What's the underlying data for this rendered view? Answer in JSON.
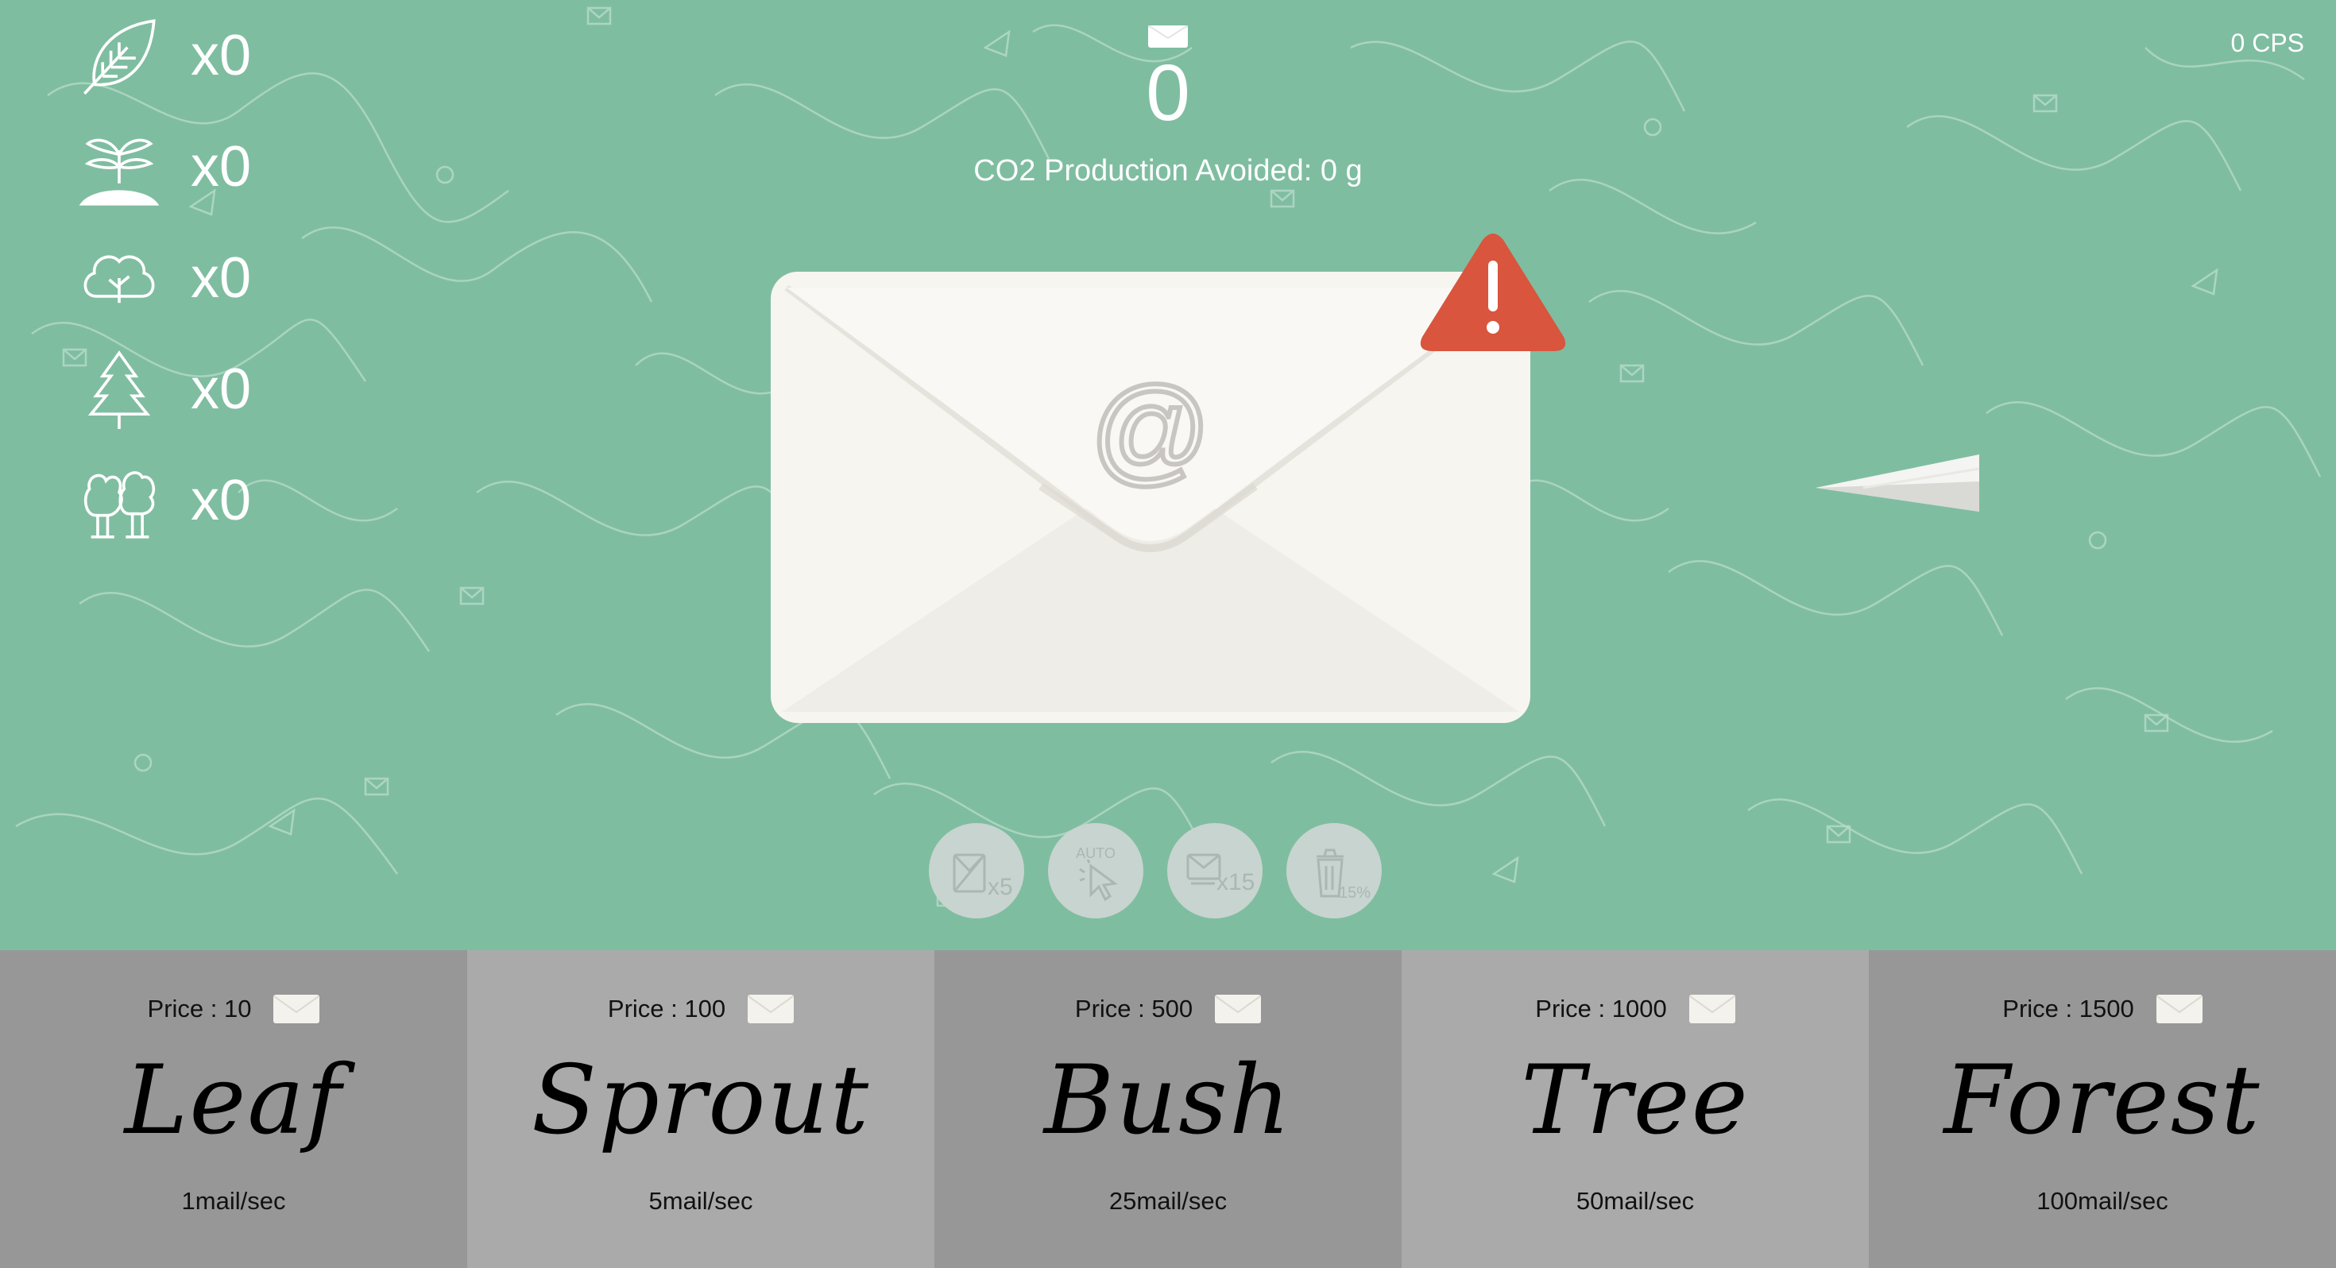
{
  "header": {
    "mail_count": "0",
    "co2_text": "CO2 Production Avoided: 0 g",
    "cps_text": "0 CPS"
  },
  "inventory": [
    {
      "icon": "leaf-icon",
      "count": "x0"
    },
    {
      "icon": "sprout-icon",
      "count": "x0"
    },
    {
      "icon": "bush-icon",
      "count": "x0"
    },
    {
      "icon": "tree-icon",
      "count": "x0"
    },
    {
      "icon": "forest-icon",
      "count": "x0"
    }
  ],
  "powerups": [
    {
      "icon": "mail-x5-icon",
      "label": "x5"
    },
    {
      "icon": "auto-click-icon",
      "label": "AUTO"
    },
    {
      "icon": "mail-x15-icon",
      "label": "x15"
    },
    {
      "icon": "trash-15-percent-icon",
      "label": "15%"
    }
  ],
  "shop": [
    {
      "price": "Price : 10",
      "name": "Leaf",
      "rate": "1mail/sec"
    },
    {
      "price": "Price : 100",
      "name": "Sprout",
      "rate": "5mail/sec"
    },
    {
      "price": "Price : 500",
      "name": "Bush",
      "rate": "25mail/sec"
    },
    {
      "price": "Price : 1000",
      "name": "Tree",
      "rate": "50mail/sec"
    },
    {
      "price": "Price : 1500",
      "name": "Forest",
      "rate": "100mail/sec"
    }
  ],
  "colors": {
    "background": "#7fbda1",
    "shop_dark": "#979797",
    "shop_light": "#aaaaaa",
    "envelope": "#f7f5f0",
    "alert": "#d9553d",
    "powerup": "#c8d4cf"
  }
}
